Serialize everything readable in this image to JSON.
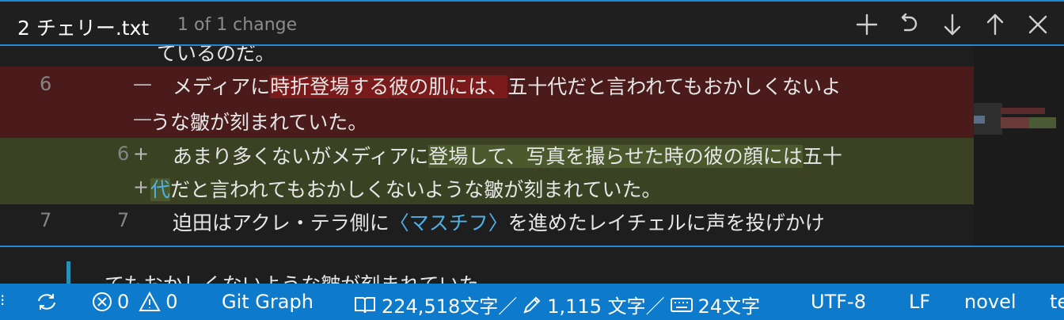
{
  "peek": {
    "title": "2 チェリー.txt",
    "subtitle": "1 of 1 change",
    "actions": [
      "add",
      "revert",
      "next-change",
      "previous-change",
      "close"
    ]
  },
  "diff": {
    "top_partial": "ているのだ。",
    "deleted": {
      "line_number": "6",
      "sign": "—",
      "line1_a": "メディアに",
      "line1_hl": "時折登場する彼の肌には、",
      "line1_b": "五十代だと言われてもおかしくないよ",
      "line2_sign": "—",
      "line2": "うな皺が刻まれていた。"
    },
    "added": {
      "line_number": "6",
      "sign": "+",
      "line1_a": "あまり多くないがメディアに",
      "line1_hl": "登場して、写真を撮らせた時の彼の顔には",
      "line1_b": "五十",
      "line2_sign": "+",
      "line2_hl": "代",
      "line2": "だと言われてもおかしくないような皺が刻まれていた。"
    },
    "context": {
      "orig_number": "7",
      "mod_number": "7",
      "text_a": "迫田はアクレ・テラ側に",
      "text_blue": "〈マスチフ〉",
      "text_b": "を進めたレイチェルに声を投げかけ"
    },
    "bottom_partial": "."
  },
  "editor_under": {
    "text": "てもおかしくないような皺が刻まれていた"
  },
  "statusbar": {
    "left_glyph": "⁝",
    "errors": "0",
    "warnings": "0",
    "git_graph": "Git Graph",
    "word_count": "224,518文字／",
    "selection_count": "1,115 文字／",
    "line_count": "24文字",
    "encoding": "UTF-8",
    "eol": "LF",
    "language": "novel",
    "trailing": "te"
  },
  "colors": {
    "accent": "#1f8ad2",
    "status_bg": "#0e7acc",
    "deleted_bg": "#4b1b1b",
    "deleted_hl": "#7a1a1a",
    "added_bg": "#3b4224",
    "added_hl": "#4b5a2d",
    "link_blue": "#4fb0e8"
  }
}
